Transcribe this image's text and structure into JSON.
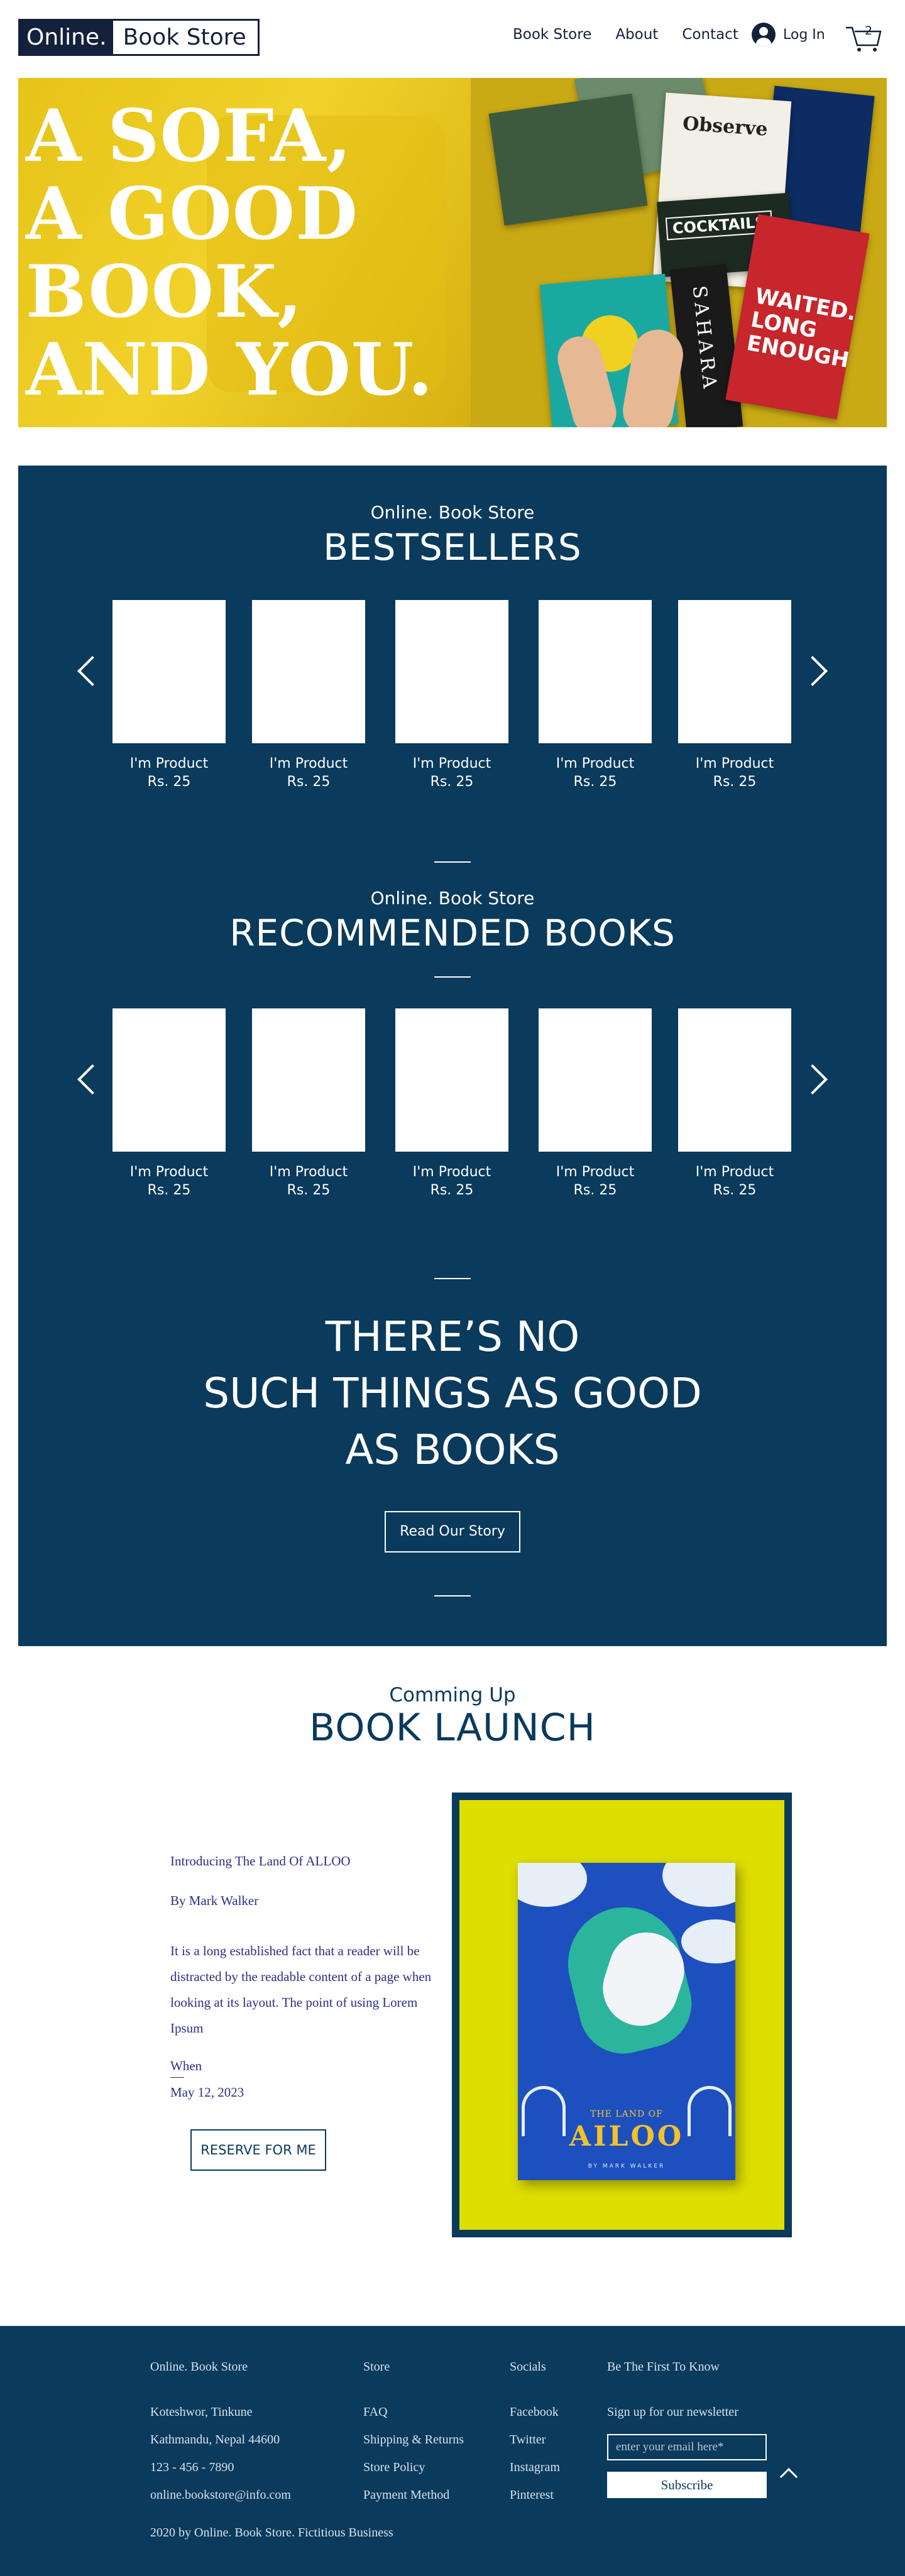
{
  "header": {
    "logo_part1": "Online.",
    "logo_part2": "Book Store",
    "nav": [
      "Book Store",
      "About",
      "Contact"
    ],
    "login_label": "Log In",
    "cart_count": "2"
  },
  "hero": {
    "lines": [
      "A SOFA,",
      "A GOOD",
      "BOOK,",
      "AND YOU."
    ],
    "book_titles": [
      "Observe",
      "COCKTAILS",
      "SAHARA",
      "WAITED. LONG ENOUGH"
    ]
  },
  "bestsellers": {
    "eyebrow": "Online. Book Store",
    "title": "BESTSELLERS",
    "products": [
      {
        "name": "I'm Product",
        "price": "Rs. 25"
      },
      {
        "name": "I'm Product",
        "price": "Rs. 25"
      },
      {
        "name": "I'm Product",
        "price": "Rs. 25"
      },
      {
        "name": "I'm Product",
        "price": "Rs. 25"
      },
      {
        "name": "I'm Product",
        "price": "Rs. 25"
      }
    ]
  },
  "recommended": {
    "eyebrow": "Online. Book Store",
    "title": "RECOMMENDED BOOKS",
    "products": [
      {
        "name": "I'm Product",
        "price": "Rs. 25"
      },
      {
        "name": "I'm Product",
        "price": "Rs. 25"
      },
      {
        "name": "I'm Product",
        "price": "Rs. 25"
      },
      {
        "name": "I'm Product",
        "price": "Rs. 25"
      },
      {
        "name": "I'm Product",
        "price": "Rs. 25"
      }
    ]
  },
  "quote": {
    "lines": [
      "THERE’S NO",
      "SUCH THINGS AS GOOD",
      "AS BOOKS"
    ],
    "button": "Read Our Story"
  },
  "launch": {
    "eyebrow": "Comming Up",
    "title": "BOOK LAUNCH",
    "intro": "Introducing The Land Of ALLOO",
    "author": "By Mark Walker",
    "description": "It is a long established fact that a reader will be distracted by the readable content of a page when looking at its  layout. The point of using Lorem Ipsum",
    "when_label": "When",
    "date": "May 12, 2023",
    "button": "RESERVE FOR ME",
    "cover_small": "THE LAND OF",
    "cover_title": "AILOO",
    "cover_author": "BY MARK WALKER"
  },
  "footer": {
    "col1": {
      "title": "Online. Book Store",
      "lines": [
        "Koteshwor, Tinkune",
        "Kathmandu, Nepal 44600",
        "123 - 456 - 7890",
        "online.bookstore@info.com"
      ]
    },
    "col2": {
      "title": "Store",
      "links": [
        "FAQ",
        "Shipping & Returns",
        "Store Policy",
        "Payment Method"
      ]
    },
    "col3": {
      "title": "Socials",
      "links": [
        "Facebook",
        "Twitter",
        "Instagram",
        "Pinterest"
      ]
    },
    "col4": {
      "title": "Be The First To Know",
      "subtitle": "Sign up for our newsletter",
      "placeholder": "enter your email here*",
      "button": "Subscribe"
    },
    "copyright": "2020 by Online. Book Store. Fictitious Business"
  },
  "colors": {
    "navy": "#0a3a5c",
    "dark": "#14213d",
    "hero_yellow": "#e8c51c",
    "cover_yellow": "#dede00"
  }
}
